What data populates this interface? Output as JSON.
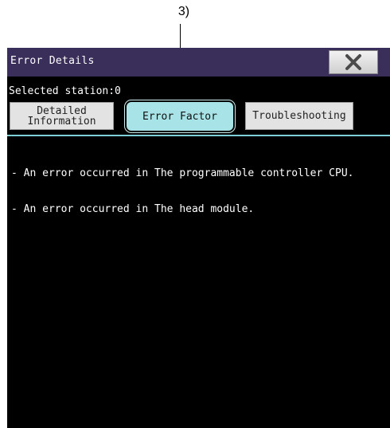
{
  "callout": {
    "label": "3)"
  },
  "window": {
    "title": "Error Details",
    "close_icon": "close-x-icon"
  },
  "station": {
    "text": "Selected station:0"
  },
  "tabs": [
    {
      "label_line1": "Detailed",
      "label_line2": "Information",
      "selected": false
    },
    {
      "label": "Error Factor",
      "selected": true
    },
    {
      "label": "Troubleshooting",
      "selected": false
    }
  ],
  "content": {
    "lines": [
      "- An error occurred in The programmable controller CPU.",
      "- An error occurred in The head module."
    ]
  },
  "colors": {
    "title_bar": "#3a2f5a",
    "selected_tab": "#a8e3e7",
    "background": "#000000",
    "divider": "#7ecfd6"
  }
}
